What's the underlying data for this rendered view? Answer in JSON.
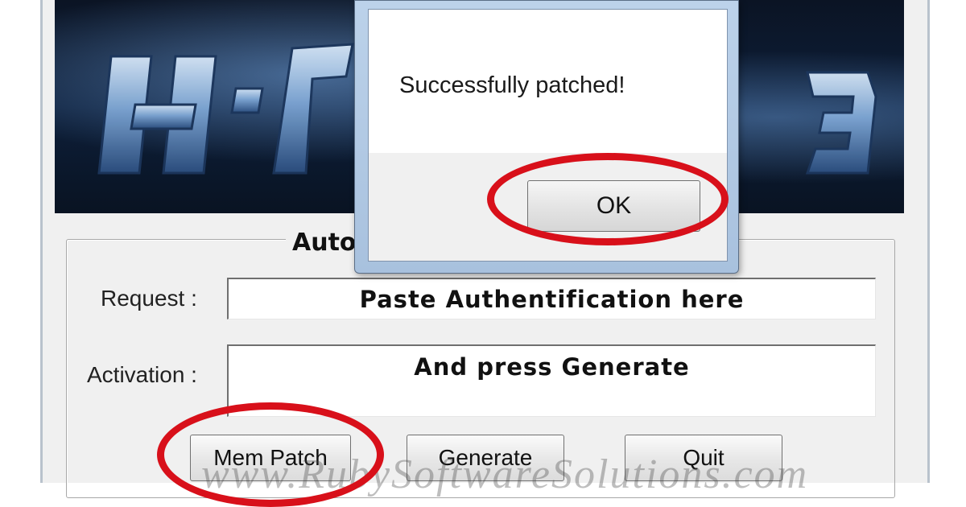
{
  "main_window": {
    "group_title": "Auto",
    "request_label": "Request :",
    "request_value": "Paste Authentification here",
    "activation_label": "Activation :",
    "activation_value": "And press Generate",
    "buttons": {
      "mem_patch": "Mem Patch",
      "generate": "Generate",
      "quit": "Quit"
    },
    "watermark": "www.RubySoftwareSolutions.com"
  },
  "dialog": {
    "message": "Successfully patched!",
    "ok_label": "OK"
  },
  "colors": {
    "highlight_ring": "#d8101a",
    "banner_dark": "#0d1f3a"
  },
  "icons": [
    "banner-logo-icon"
  ]
}
